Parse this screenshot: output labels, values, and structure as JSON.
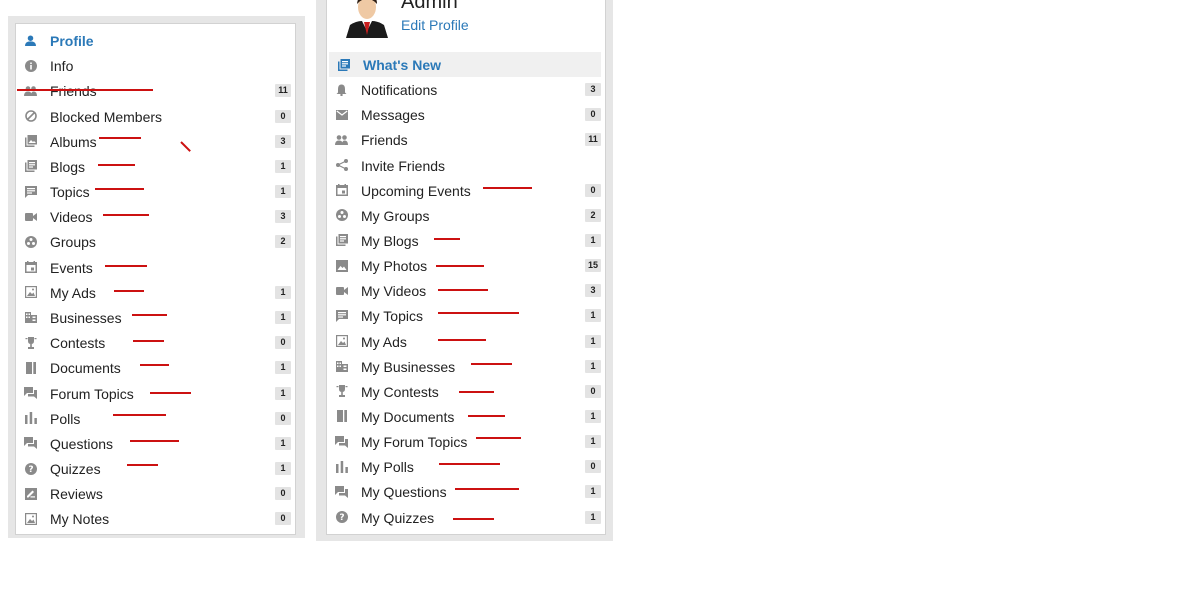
{
  "left_panel": {
    "items": [
      {
        "label": "Profile",
        "icon": "person-icon",
        "active": true
      },
      {
        "label": "Info",
        "icon": "info-icon"
      },
      {
        "label": "Friends",
        "icon": "friends-icon",
        "count": "11"
      },
      {
        "label": "Blocked Members",
        "icon": "block-icon",
        "count": "0"
      },
      {
        "label": "Albums",
        "icon": "photo-album-icon",
        "count": "3"
      },
      {
        "label": "Blogs",
        "icon": "blog-icon",
        "count": "1"
      },
      {
        "label": "Topics",
        "icon": "topic-icon",
        "count": "1"
      },
      {
        "label": "Videos",
        "icon": "video-icon",
        "count": "3"
      },
      {
        "label": "Groups",
        "icon": "groups-icon",
        "count": "2"
      },
      {
        "label": "Events",
        "icon": "calendar-icon"
      },
      {
        "label": "My Ads",
        "icon": "ads-icon",
        "count": "1"
      },
      {
        "label": "Businesses",
        "icon": "business-icon",
        "count": "1"
      },
      {
        "label": "Contests",
        "icon": "trophy-icon",
        "count": "0"
      },
      {
        "label": "Documents",
        "icon": "document-icon",
        "count": "1"
      },
      {
        "label": "Forum Topics",
        "icon": "forum-icon",
        "count": "1"
      },
      {
        "label": "Polls",
        "icon": "poll-icon",
        "count": "0"
      },
      {
        "label": "Questions",
        "icon": "question-forum-icon",
        "count": "1"
      },
      {
        "label": "Quizzes",
        "icon": "quiz-icon",
        "count": "1"
      },
      {
        "label": "Reviews",
        "icon": "review-icon",
        "count": "0"
      },
      {
        "label": "My Notes",
        "icon": "notes-icon",
        "count": "0"
      }
    ]
  },
  "right_panel": {
    "user": {
      "name": "Admin",
      "edit_label": "Edit Profile"
    },
    "items": [
      {
        "label": "What's New",
        "icon": "news-feed-icon",
        "active": true
      },
      {
        "label": "Notifications",
        "icon": "bell-icon",
        "count": "3"
      },
      {
        "label": "Messages",
        "icon": "mail-icon",
        "count": "0"
      },
      {
        "label": "Friends",
        "icon": "friends-icon",
        "count": "11"
      },
      {
        "label": "Invite Friends",
        "icon": "share-icon"
      },
      {
        "label": "Upcoming Events",
        "icon": "calendar-icon",
        "count": "0"
      },
      {
        "label": "My Groups",
        "icon": "groups-icon",
        "count": "2"
      },
      {
        "label": "My Blogs",
        "icon": "blog-icon",
        "count": "1"
      },
      {
        "label": "My Photos",
        "icon": "photo-icon",
        "count": "15"
      },
      {
        "label": "My Videos",
        "icon": "video-icon",
        "count": "3"
      },
      {
        "label": "My Topics",
        "icon": "topic-icon",
        "count": "1"
      },
      {
        "label": "My Ads",
        "icon": "ads-icon",
        "count": "1"
      },
      {
        "label": "My Businesses",
        "icon": "business-icon",
        "count": "1"
      },
      {
        "label": "My Contests",
        "icon": "trophy-icon",
        "count": "0"
      },
      {
        "label": "My Documents",
        "icon": "document-icon",
        "count": "1"
      },
      {
        "label": "My Forum Topics",
        "icon": "forum-icon",
        "count": "1"
      },
      {
        "label": "My Polls",
        "icon": "poll-icon",
        "count": "0"
      },
      {
        "label": "My Questions",
        "icon": "question-forum-icon",
        "count": "1"
      },
      {
        "label": "My Quizzes",
        "icon": "quiz-icon",
        "count": "1"
      }
    ]
  },
  "colors": {
    "accent": "#2b79b8",
    "annotation": "#cc1111",
    "icon": "#8a8a8a",
    "badge": "#e3e3e3"
  }
}
